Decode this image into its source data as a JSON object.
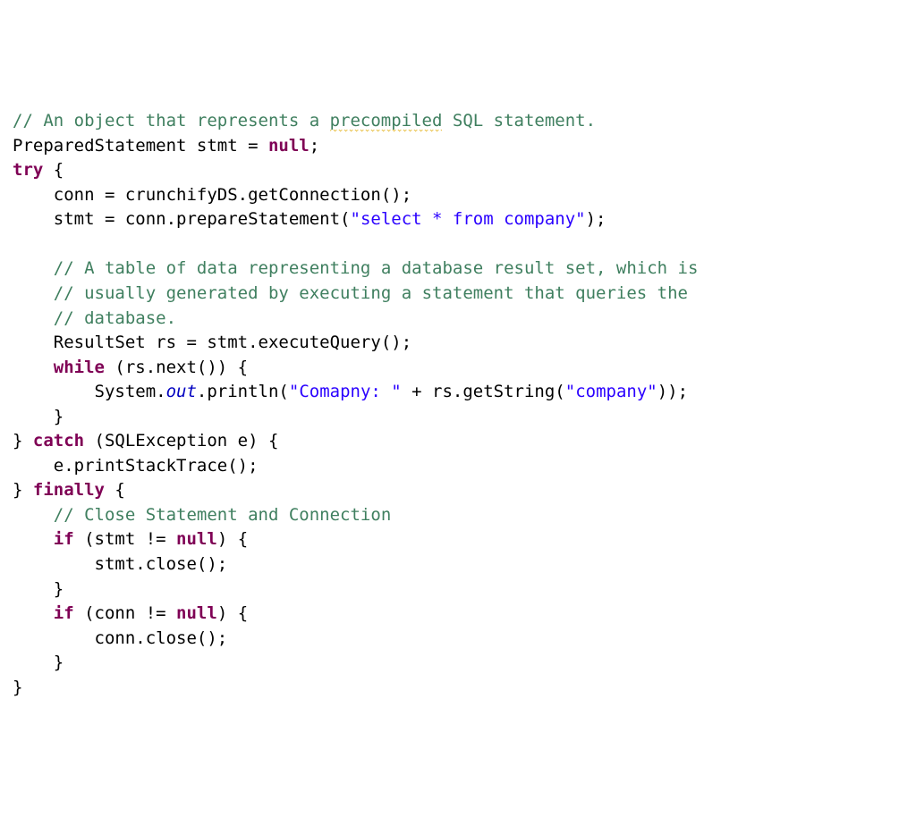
{
  "code": {
    "lines": [
      {
        "indent": 0,
        "tokens": [
          {
            "t": "// An object that represents a ",
            "cls": "c-comment"
          },
          {
            "t": "precompiled",
            "cls": "c-comment squiggle"
          },
          {
            "t": " SQL statement.",
            "cls": "c-comment"
          }
        ]
      },
      {
        "indent": 0,
        "tokens": [
          {
            "t": "PreparedStatement stmt = ",
            "cls": "c-default"
          },
          {
            "t": "null",
            "cls": "c-keyword"
          },
          {
            "t": ";",
            "cls": "c-default"
          }
        ]
      },
      {
        "indent": 0,
        "tokens": [
          {
            "t": "try",
            "cls": "c-keyword"
          },
          {
            "t": " {",
            "cls": "c-default"
          }
        ]
      },
      {
        "indent": 1,
        "tokens": [
          {
            "t": "conn = crunchifyDS.getConnection();",
            "cls": "c-default"
          }
        ]
      },
      {
        "indent": 1,
        "tokens": [
          {
            "t": "stmt = conn.prepareStatement(",
            "cls": "c-default"
          },
          {
            "t": "\"select * from company\"",
            "cls": "c-string"
          },
          {
            "t": ");",
            "cls": "c-default"
          }
        ]
      },
      {
        "indent": 0,
        "tokens": []
      },
      {
        "indent": 1,
        "tokens": [
          {
            "t": "// A table of data representing a database result set, which is",
            "cls": "c-comment"
          }
        ]
      },
      {
        "indent": 1,
        "tokens": [
          {
            "t": "// usually generated by executing a statement that queries the",
            "cls": "c-comment"
          }
        ]
      },
      {
        "indent": 1,
        "tokens": [
          {
            "t": "// database.",
            "cls": "c-comment"
          }
        ]
      },
      {
        "indent": 1,
        "tokens": [
          {
            "t": "ResultSet rs = stmt.executeQuery();",
            "cls": "c-default"
          }
        ]
      },
      {
        "indent": 1,
        "tokens": [
          {
            "t": "while",
            "cls": "c-keyword"
          },
          {
            "t": " (rs.next()) {",
            "cls": "c-default"
          }
        ]
      },
      {
        "indent": 2,
        "tokens": [
          {
            "t": "System.",
            "cls": "c-default"
          },
          {
            "t": "out",
            "cls": "c-static"
          },
          {
            "t": ".println(",
            "cls": "c-default"
          },
          {
            "t": "\"Comapny: \"",
            "cls": "c-string"
          },
          {
            "t": " + rs.getString(",
            "cls": "c-default"
          },
          {
            "t": "\"company\"",
            "cls": "c-string"
          },
          {
            "t": "));",
            "cls": "c-default"
          }
        ]
      },
      {
        "indent": 1,
        "tokens": [
          {
            "t": "}",
            "cls": "c-default"
          }
        ]
      },
      {
        "indent": 0,
        "tokens": [
          {
            "t": "} ",
            "cls": "c-default"
          },
          {
            "t": "catch",
            "cls": "c-keyword"
          },
          {
            "t": " (SQLException e) {",
            "cls": "c-default"
          }
        ]
      },
      {
        "indent": 1,
        "tokens": [
          {
            "t": "e.printStackTrace();",
            "cls": "c-default"
          }
        ]
      },
      {
        "indent": 0,
        "tokens": [
          {
            "t": "} ",
            "cls": "c-default"
          },
          {
            "t": "finally",
            "cls": "c-keyword"
          },
          {
            "t": " {",
            "cls": "c-default"
          }
        ]
      },
      {
        "indent": 1,
        "tokens": [
          {
            "t": "// Close Statement and Connection",
            "cls": "c-comment"
          }
        ]
      },
      {
        "indent": 1,
        "tokens": [
          {
            "t": "if",
            "cls": "c-keyword"
          },
          {
            "t": " (stmt != ",
            "cls": "c-default"
          },
          {
            "t": "null",
            "cls": "c-keyword"
          },
          {
            "t": ") {",
            "cls": "c-default"
          }
        ]
      },
      {
        "indent": 2,
        "tokens": [
          {
            "t": "stmt.close();",
            "cls": "c-default"
          }
        ]
      },
      {
        "indent": 1,
        "tokens": [
          {
            "t": "}",
            "cls": "c-default"
          }
        ]
      },
      {
        "indent": 1,
        "tokens": [
          {
            "t": "if",
            "cls": "c-keyword"
          },
          {
            "t": " (conn != ",
            "cls": "c-default"
          },
          {
            "t": "null",
            "cls": "c-keyword"
          },
          {
            "t": ") {",
            "cls": "c-default"
          }
        ]
      },
      {
        "indent": 2,
        "tokens": [
          {
            "t": "conn.close();",
            "cls": "c-default"
          }
        ]
      },
      {
        "indent": 1,
        "tokens": [
          {
            "t": "}",
            "cls": "c-default"
          }
        ]
      },
      {
        "indent": 0,
        "tokens": [
          {
            "t": "}",
            "cls": "c-default"
          }
        ]
      }
    ],
    "indent_unit": "    "
  }
}
